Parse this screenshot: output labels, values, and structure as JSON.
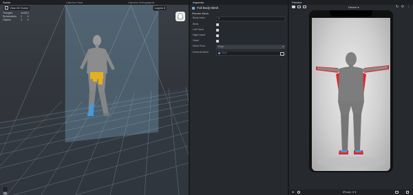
{
  "scene": {
    "tab_title": "Scene",
    "camera_labels": [
      "Camera Face",
      "Camera Orthographic"
    ],
    "view_button": "View 2D Scene",
    "layers_button": "Layers ▾",
    "stats": [
      {
        "label": "Triangles",
        "value": "44451",
        "extra": "0"
      },
      {
        "label": "Renderables",
        "value": "2",
        "extra": "0"
      },
      {
        "label": "Objects",
        "value": "3",
        "extra": "0"
      }
    ]
  },
  "inspector": {
    "tab_title": "Inspector",
    "object_title": "Full Body Mesh",
    "section_title": "Render Mesh",
    "body_index_label": "Body Index",
    "body_index_value": "0",
    "checks": [
      {
        "label": "Body"
      },
      {
        "label": "Left Hand"
      },
      {
        "label": "Right Hand"
      },
      {
        "label": "Head"
      }
    ],
    "mesh_pivot_label": "Mesh Pivot",
    "mesh_pivot_value": "Pivot",
    "external_mesh_label": "External Mesh",
    "external_mesh_value": "None"
  },
  "preview": {
    "tab_title": "Preview",
    "device_dropdown": "Device ▾",
    "device_name": "iPhone X ▾"
  },
  "colors": {
    "accent_yellow": "#e4b11c",
    "accent_blue": "#3e9ce6",
    "outline_red": "#e3262a",
    "grid": "#7f8fa0"
  }
}
